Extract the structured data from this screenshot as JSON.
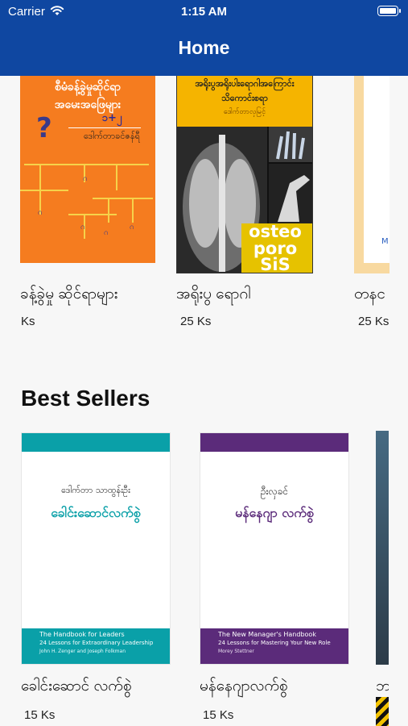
{
  "status": {
    "carrier": "Carrier",
    "time": "1:15 AM"
  },
  "nav": {
    "title": "Home"
  },
  "row1": {
    "books": [
      {
        "title": "ခန့်ခွဲမှု ဆိုင်ရာများ",
        "price": "Ks",
        "cover_lines": [
          "စီမံခန့်ခွဲမှုဆိုင်ရာ",
          "အမေးအဖြေများ",
          "၁+၂",
          "ဒေါက်တာခင်ဇန်ရီ"
        ]
      },
      {
        "title": "အရိုးပွ ရောဂါ",
        "price": "25 Ks",
        "cover_lines": [
          "အရိုးပွအရိုးပါးရောဂါအကြောင်း",
          "သိကောင်းစရာ",
          "ဒေါက်တာလှမြင့်",
          "osteo",
          "poro",
          "SiS"
        ]
      },
      {
        "title": "တနင",
        "price": "25 Ks",
        "cover_lines": [
          "M"
        ]
      }
    ]
  },
  "section": {
    "best_sellers": "Best Sellers"
  },
  "row2": {
    "books": [
      {
        "title": "ခေါင်းဆောင် လက်စွဲ",
        "price": "15 Ks",
        "cover_lines": [
          "ဒေါက်တာ သာထွန်းဦး",
          "ခေါင်းဆောင်လက်စွဲ",
          "The Handbook for Leaders",
          "24 Lessons for Extraordinary Leadership",
          "John H. Zenger and Joseph Folkman"
        ]
      },
      {
        "title": "မန်နေဂျာလက်စွဲ",
        "price": "15 Ks",
        "cover_lines": [
          "ဦးလှခင်",
          "မန်နေဂျာ လက်စွဲ",
          "The New Manager's Handbook",
          "24 Lessons for Mastering Your New Role",
          "Morey Stettner"
        ]
      },
      {
        "title": "ဘ",
        "price": "",
        "cover_lines": []
      }
    ]
  },
  "colors": {
    "nav": "#0f47a1",
    "cover1": "#f57c1f",
    "cover2_band": "#f5b400",
    "teal": "#0aa0a8",
    "purple": "#5b2b7a"
  }
}
